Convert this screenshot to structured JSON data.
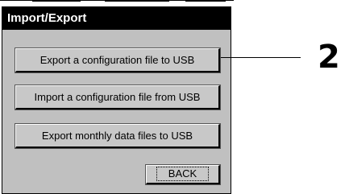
{
  "window": {
    "title": "Import/Export"
  },
  "buttons": {
    "export_config": "Export a configuration file to USB",
    "import_config": "Import a configuration file from USB",
    "export_monthly": "Export monthly data files to USB",
    "back": "BACK"
  },
  "callout": {
    "number": "2"
  },
  "colors": {
    "title_bar": "#000000",
    "dialog_background": "#c0c0c0",
    "button_face": "#c8c8c8"
  }
}
